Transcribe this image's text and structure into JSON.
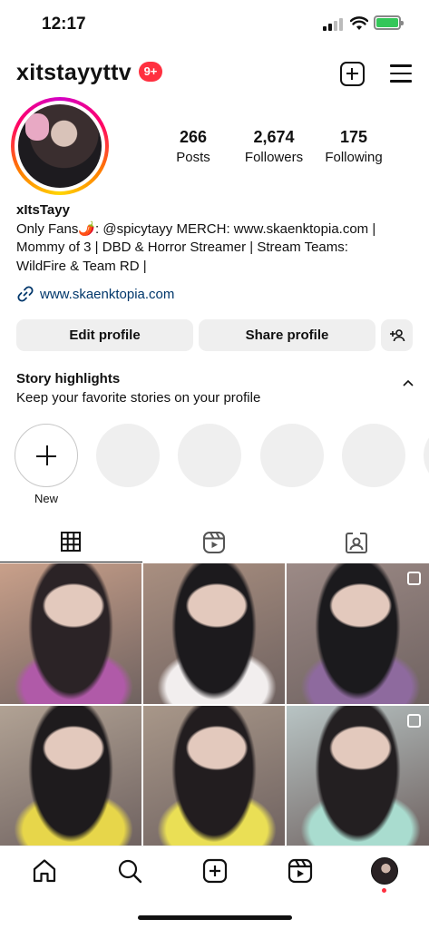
{
  "status_bar": {
    "time": "12:17"
  },
  "header": {
    "username": "xitstayyttv",
    "notification_count": "9+"
  },
  "profile": {
    "stats": [
      {
        "value": "266",
        "label": "Posts"
      },
      {
        "value": "2,674",
        "label": "Followers"
      },
      {
        "value": "175",
        "label": "Following"
      }
    ],
    "name": "xItsTayy",
    "bio_line1": "Only Fans🌶️: @spicytayy MERCH: www.skaenktopia.com |",
    "bio_line2": "Mommy of 3 | DBD & Horror Streamer | Stream Teams:",
    "bio_line3": "WildFire & Team RD |",
    "link": "www.skaenktopia.com"
  },
  "actions": {
    "edit": "Edit profile",
    "share": "Share profile"
  },
  "highlights": {
    "title": "Story highlights",
    "subtitle": "Keep your favorite stories on your profile",
    "new_label": "New"
  },
  "tabs": [
    {
      "icon": "grid-icon",
      "active": true
    },
    {
      "icon": "reels-icon",
      "active": false
    },
    {
      "icon": "tagged-icon",
      "active": false
    }
  ],
  "posts": [
    {
      "colors": [
        "#c9a08a",
        "#2b2326",
        "#b05aa8"
      ],
      "multi": false
    },
    {
      "colors": [
        "#a98f80",
        "#1c1a1d",
        "#f2eeee"
      ],
      "multi": false
    },
    {
      "colors": [
        "#9c8a86",
        "#1b1a1d",
        "#8e6a9e"
      ],
      "multi": true
    },
    {
      "colors": [
        "#b1a294",
        "#1e1b1d",
        "#e7d64a"
      ],
      "multi": false
    },
    {
      "colors": [
        "#a89789",
        "#221d1f",
        "#eadf55"
      ],
      "multi": false
    },
    {
      "colors": [
        "#b8c4c4",
        "#231f21",
        "#a9dccf"
      ],
      "multi": true
    }
  ],
  "bottom_nav": [
    "home-icon",
    "search-icon",
    "create-icon",
    "reels-icon",
    "profile-avatar"
  ]
}
